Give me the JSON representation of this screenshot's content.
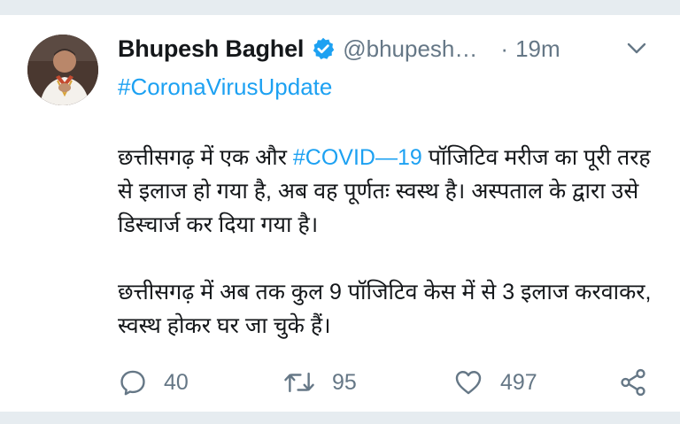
{
  "tweet": {
    "display_name": "Bhupesh Baghel",
    "handle": "@bhupesh…",
    "separator": "·",
    "time": "19m",
    "hashtag": "#CoronaVirusUpdate",
    "body": {
      "p1_before": "छत्तीसगढ़ में एक और ",
      "p1_tag": "#COVID—19",
      "p1_after": " पॉजिटिव मरीज का पूरी तरह से इलाज हो गया है, अब वह पूर्णतः स्वस्थ है। अस्पताल के द्वारा उसे डिस्चार्ज कर दिया गया है।",
      "p2": "छत्तीसगढ़ में अब तक कुल 9 पॉजिटिव केस में से 3 इलाज करवाकर, स्वस्थ होकर घर जा चुके हैं।"
    },
    "actions": {
      "replies": "40",
      "retweets": "95",
      "likes": "497"
    }
  },
  "icons": {
    "verified": "verified-badge-icon",
    "menu": "chevron-down-icon",
    "reply": "reply-icon",
    "retweet": "retweet-icon",
    "like": "heart-icon",
    "share": "share-icon"
  },
  "colors": {
    "accent": "#1da1f2",
    "text": "#14171a",
    "muted": "#657786",
    "background_band": "#e6ecf0"
  }
}
